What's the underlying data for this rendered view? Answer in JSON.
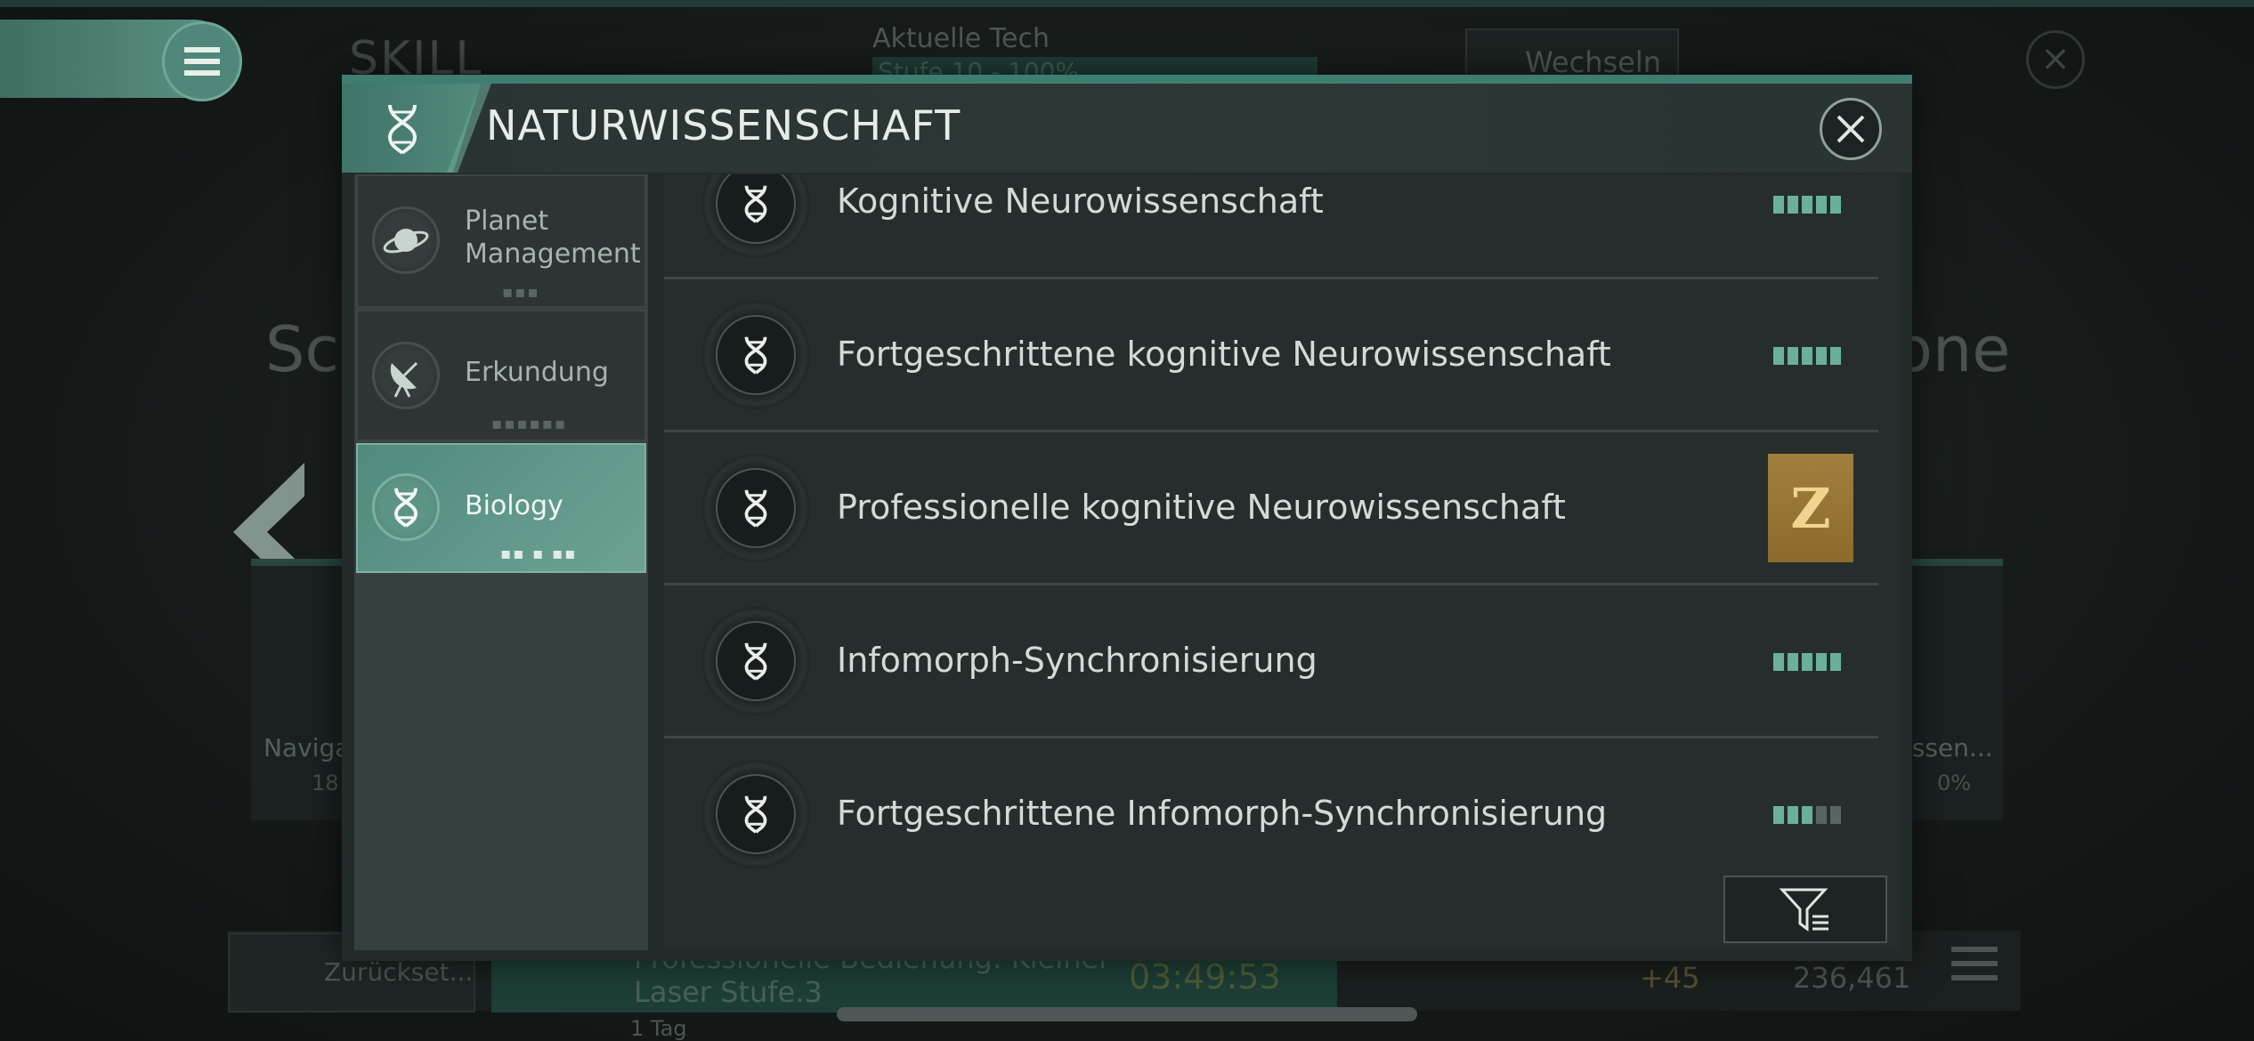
{
  "background": {
    "skill_title": "SKILL",
    "aktuelle_tech": "Aktuelle Tech",
    "stufe_text": "Stufe 10 - 100%",
    "wechseln": "Wechseln",
    "sc_text": "Sc",
    "one_text": "one",
    "left_card_title": "Naviga",
    "left_card_value": "18",
    "right_card_title": "issen...",
    "right_card_value": "0%",
    "reset_label": "Zurückset...",
    "queue_line1": "Professionelle Bedienung: Kleiner",
    "queue_line2": "Laser Stufe.3",
    "queue_timer": "03:49:53",
    "queue_days": "1 Tag",
    "resource_plus": "+45",
    "resource_count": "236,461"
  },
  "dialog": {
    "title": "NATURWISSENSCHAFT",
    "categories": [
      {
        "label": "Planet Management",
        "icon": "planet-icon",
        "dots": "▪▪▪",
        "active": false
      },
      {
        "label": "Erkundung",
        "icon": "satellite-dish-icon",
        "dots": "▪▪▪▪▪▪",
        "active": false
      },
      {
        "label": "Biology",
        "icon": "dna-icon",
        "dots": "▪▪ ▪ ▪▪",
        "active": true
      }
    ],
    "skills": [
      {
        "name": "Kognitive Neurowissenschaft",
        "icon": "dna-icon",
        "level_filled": 5,
        "level_total": 5
      },
      {
        "name": "Fortgeschrittene kognitive Neurowissenschaft",
        "icon": "dna-icon",
        "level_filled": 5,
        "level_total": 5
      },
      {
        "name": "Professionelle kognitive Neurowissenschaft",
        "icon": "dna-icon",
        "badge": "Z"
      },
      {
        "name": "Infomorph-Synchronisierung",
        "icon": "dna-icon",
        "level_filled": 5,
        "level_total": 5
      },
      {
        "name": "Fortgeschrittene Infomorph-Synchronisierung",
        "icon": "dna-icon",
        "level_filled": 3,
        "level_total": 5
      }
    ],
    "filter_icon": "filter-icon",
    "close_icon": "close-icon"
  },
  "colors": {
    "accent": "#5b9485",
    "level_on": "#6bb09a",
    "level_off": "#5a6462",
    "badge_gold": "#a17f3e"
  }
}
